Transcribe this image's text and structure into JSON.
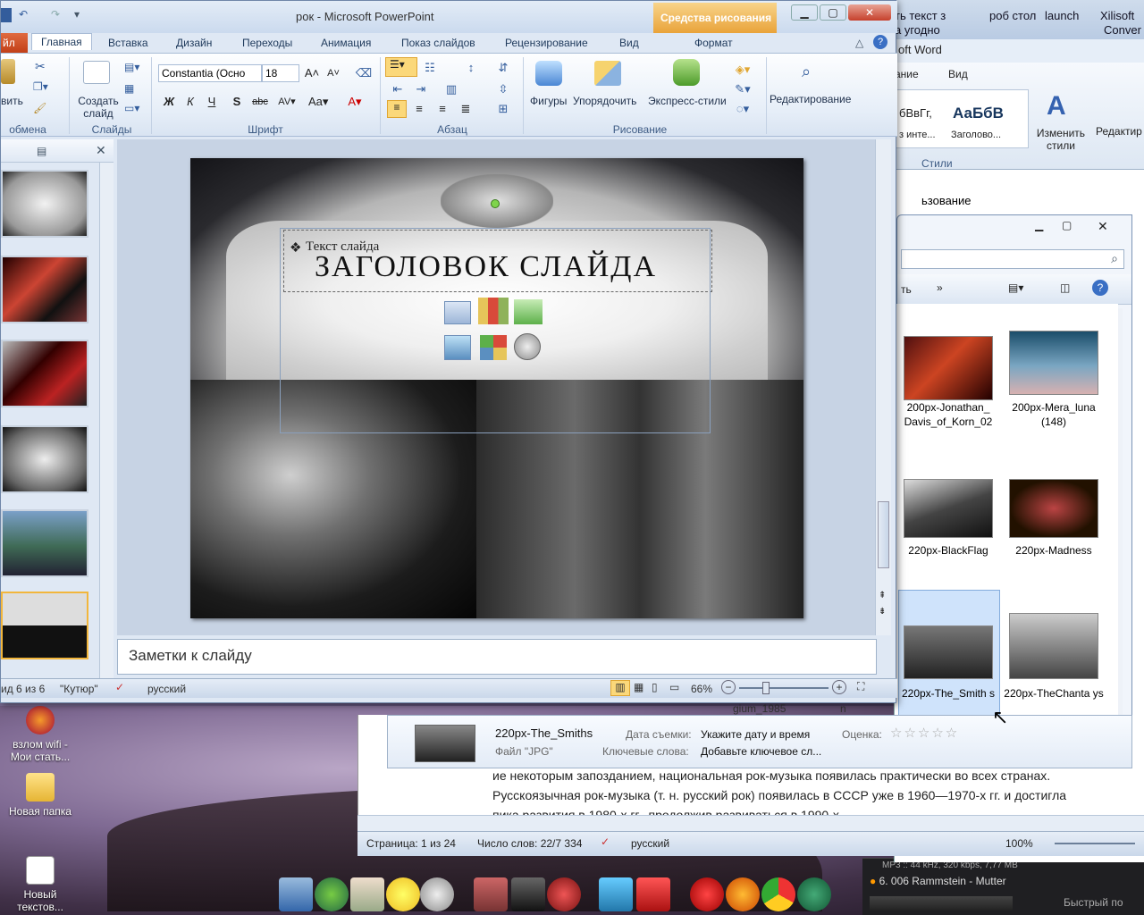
{
  "ppt": {
    "title": "рок  -  Microsoft PowerPoint",
    "context_tab_title": "Средства рисования",
    "tabs": [
      "Главная",
      "Вставка",
      "Дизайн",
      "Переходы",
      "Анимация",
      "Показ слайдов",
      "Рецензирование",
      "Вид",
      "Формат"
    ],
    "file_tab": "йл",
    "ribbon": {
      "paste_label": "вить",
      "clipboard_group": "обмена",
      "create_slide": "Создать слайд",
      "slides_group": "Слайды",
      "font_name": "Constantia (Осно",
      "font_size": "18",
      "font_group": "Шрифт",
      "paragraph_group": "Абзац",
      "shapes": "Фигуры",
      "arrange": "Упорядочить",
      "quick_styles": "Экспресс-стили",
      "drawing_group": "Рисование",
      "editing": "Редактирование"
    },
    "slide": {
      "text_placeholder": "Текст слайда",
      "title": "ЗАГОЛОВОК СЛАЙДА"
    },
    "notes_placeholder": "Заметки к слайду",
    "status": {
      "slide_info": "ид 6 из 6",
      "theme": "\"Кутюр\"",
      "language": "русский",
      "zoom": "66%"
    }
  },
  "word": {
    "title_line1": "ть текст з",
    "title_line2": "а угодно",
    "title_app": "oft Word",
    "title_tab1": "роб стол",
    "title_tab2": "launch",
    "title_tab3": "Xilisoft",
    "title_tab3b": "Conver",
    "tab_a": "ание",
    "tab_b": "Вид",
    "style1": "бВвГг,",
    "style1_name": "з инте...",
    "style2": "АаБбВ",
    "style2_name": "Заголово...",
    "change_styles": "Изменить стили",
    "editing": "Редактир",
    "styles_group": "Стили",
    "body_line1": "ьзование",
    "body_para1": "ие некоторым запозданием, национальная рок-музыка появилась практически во всех странах.",
    "body_para2": "Русскоязычная рок-музыка (т. н. русский рок) появилась в СССР уже в 1960—1970-х  гг. и достигла",
    "body_para3": "пика развития в 1980-х гг., продолжив развиваться в 1990-х",
    "status": {
      "page": "Страница: 1 из 24",
      "words": "Число слов: 22/7 334",
      "language": "русский",
      "zoom": "100%"
    }
  },
  "explorer": {
    "nav_more": "ть",
    "files": [
      {
        "name": "200px-Jonathan_ Davis_of_Korn_02"
      },
      {
        "name": "200px-Mera_luna (148)"
      },
      {
        "name": "220px-BlackFlag"
      },
      {
        "name": "220px-Madness"
      },
      {
        "name": "220px-The_Smith s"
      },
      {
        "name": "220px-TheChanta ys"
      }
    ],
    "partial_file_a": "gium_1985",
    "partial_file_b": "n",
    "details": {
      "name": "220px-The_Smiths",
      "type": "Файл \"JPG\"",
      "date_label": "Дата съемки:",
      "date_value": "Укажите дату и время",
      "rating_label": "Оценка:",
      "keywords_label": "Ключевые слова:",
      "keywords_value": "Добавьте ключевое сл..."
    }
  },
  "desktop": {
    "icons": [
      {
        "label": "взлом wifi - Мои стать..."
      },
      {
        "label": "Новая папка"
      },
      {
        "label": "Новый текстов..."
      }
    ]
  },
  "player": {
    "info": "MP3 :: 44 kHz, 320 kbps, 7,77 MB",
    "track": "6. 006  Rammstein - Mutter",
    "quick": "Быстрый по"
  },
  "colors": {
    "ribbon_text": "#1e395b",
    "selection": "#f2b63c",
    "context_tab": "#e9a33a"
  }
}
